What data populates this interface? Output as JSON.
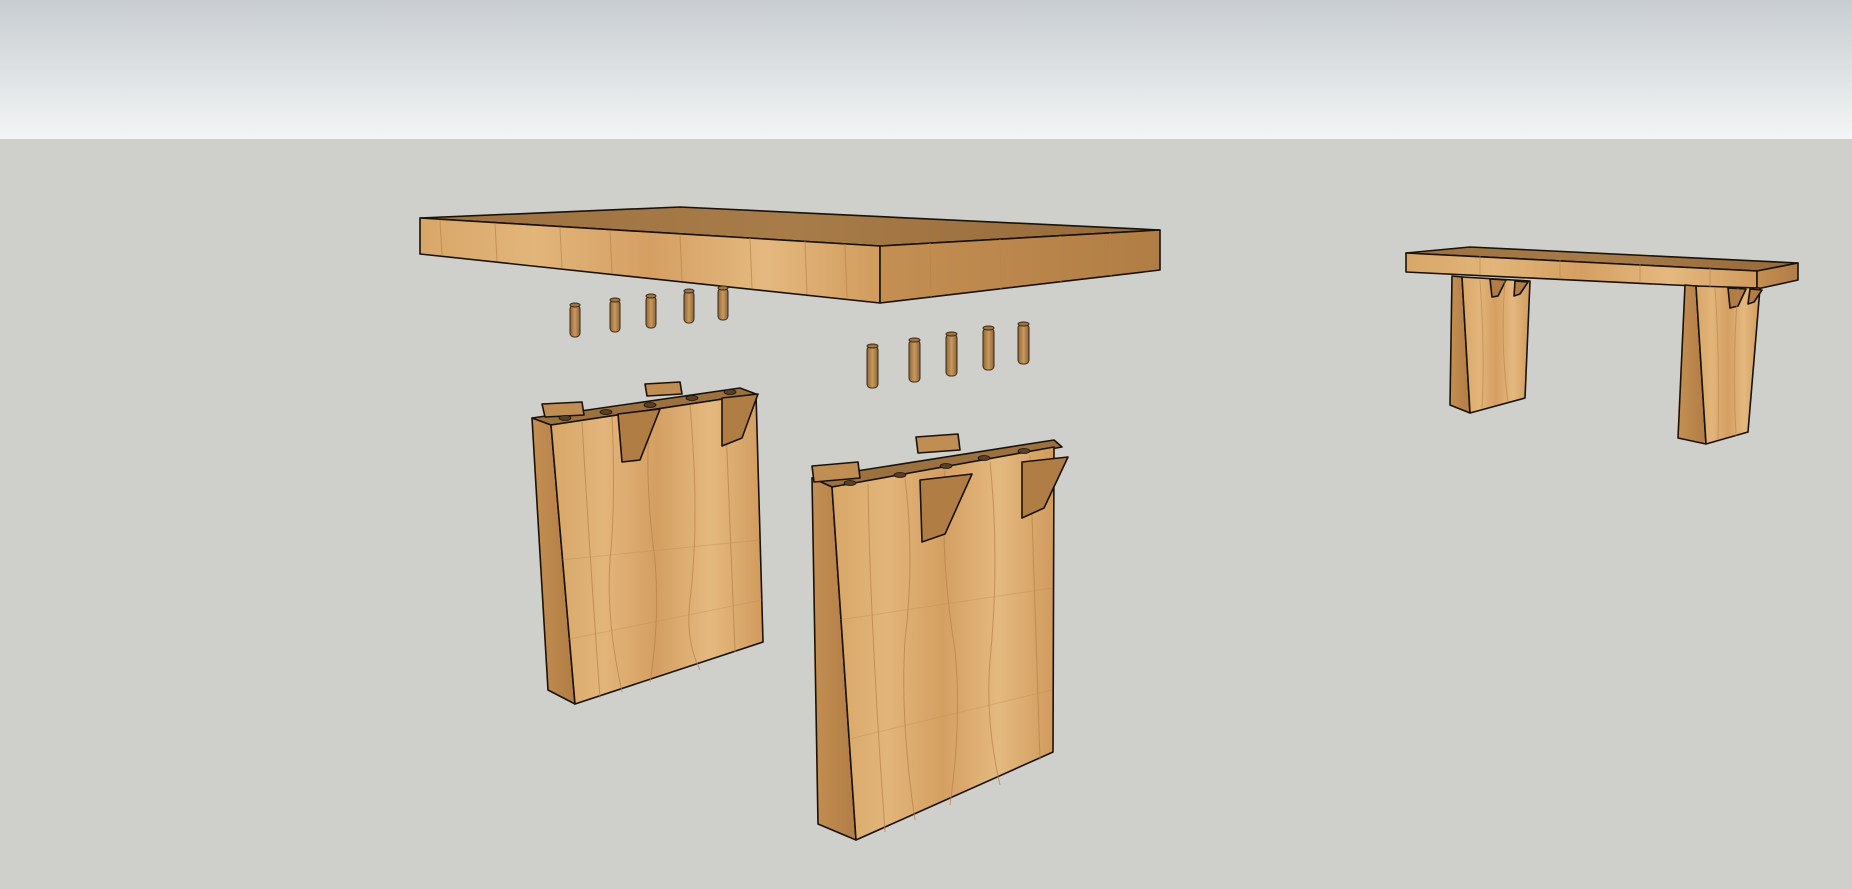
{
  "colors": {
    "sky_top": "#c9ced2",
    "sky_bottom": "#f2f4f4",
    "ground": "#cfcfcb",
    "wood_top": "#a57a45",
    "wood_front": "#d9a86c",
    "wood_side": "#b9874c",
    "wood_dark": "#7b5a33",
    "edge": "#1a1208"
  },
  "scene": {
    "objects": [
      "exploded-tabletop",
      "dowel-row-left",
      "dowel-row-right",
      "leg-panel-left",
      "leg-panel-right",
      "assembled-bench"
    ]
  }
}
